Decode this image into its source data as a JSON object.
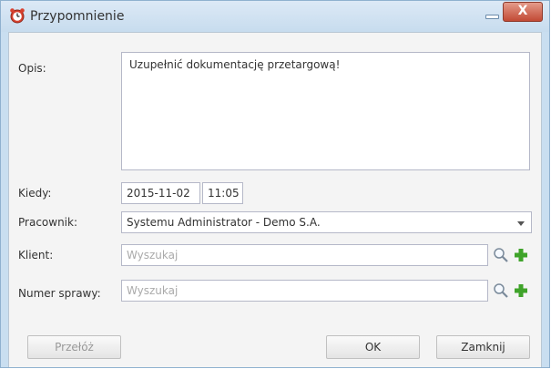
{
  "window": {
    "title": "Przypomnienie",
    "minimize_icon": "minimize-icon",
    "close_label": "X"
  },
  "form": {
    "description_label": "Opis:",
    "description_value": "Uzupełnić dokumentację przetargową!",
    "when_label": "Kiedy:",
    "date_value": "2015-11-02",
    "time_value": "11:05",
    "employee_label": "Pracownik:",
    "employee_value": "Systemu Administrator - Demo S.A.",
    "client_label": "Klient:",
    "client_placeholder": "Wyszukaj",
    "case_label": "Numer sprawy:",
    "case_placeholder": "Wyszukaj"
  },
  "buttons": {
    "postpone": "Przełóż",
    "ok": "OK",
    "close": "Zamknij"
  },
  "colors": {
    "accent": "#c24a35",
    "add_green": "#3fa32a"
  }
}
